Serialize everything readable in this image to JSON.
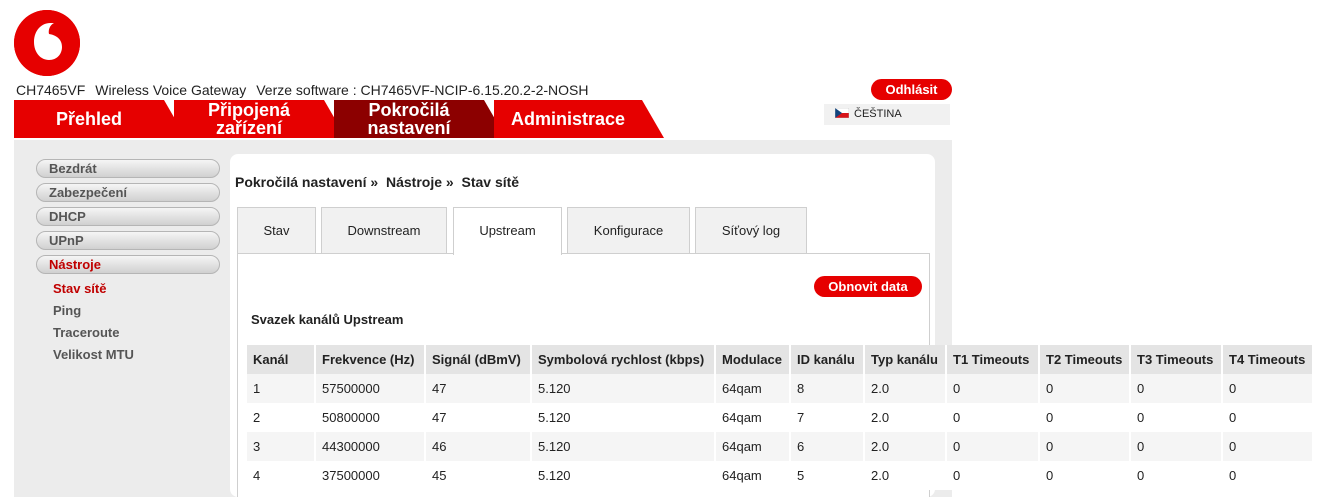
{
  "header": {
    "model": "CH7465VF",
    "product": "Wireless Voice Gateway",
    "software": "Verze software : CH7465VF-NCIP-6.15.20.2-2-NOSH",
    "logout_label": "Odhlásit",
    "language_label": "ČEŠTINA"
  },
  "nav": {
    "tab1": "Přehled",
    "tab2_line1": "Připojená",
    "tab2_line2": "zařízení",
    "tab3_line1": "Pokročilá",
    "tab3_line2": "nastavení",
    "tab4": "Administrace"
  },
  "sidebar": {
    "items": [
      "Bezdrát",
      "Zabezpečení",
      "DHCP",
      "UPnP",
      "Nástroje"
    ],
    "subitems": [
      "Stav sítě",
      "Ping",
      "Traceroute",
      "Velikost MTU"
    ]
  },
  "breadcrumb": {
    "part1": "Pokročilá nastavení",
    "sep": "»",
    "part2": "Nástroje",
    "part3": "Stav sítě"
  },
  "tabs": [
    "Stav",
    "Downstream",
    "Upstream",
    "Konfigurace",
    "Síťový log"
  ],
  "refresh_label": "Obnovit data",
  "section_title": "Svazek kanálů Upstream",
  "table": {
    "headers": [
      "Kanál",
      "Frekvence (Hz)",
      "Signál (dBmV)",
      "Symbolová rychlost (kbps)",
      "Modulace",
      "ID kanálu",
      "Typ kanálu",
      "T1 Timeouts",
      "T2 Timeouts",
      "T3 Timeouts",
      "T4 Timeouts"
    ],
    "rows": [
      [
        "1",
        "57500000",
        "47",
        "5.120",
        "64qam",
        "8",
        "2.0",
        "0",
        "0",
        "0",
        "0"
      ],
      [
        "2",
        "50800000",
        "47",
        "5.120",
        "64qam",
        "7",
        "2.0",
        "0",
        "0",
        "0",
        "0"
      ],
      [
        "3",
        "44300000",
        "46",
        "5.120",
        "64qam",
        "6",
        "2.0",
        "0",
        "0",
        "0",
        "0"
      ],
      [
        "4",
        "37500000",
        "45",
        "5.120",
        "64qam",
        "5",
        "2.0",
        "0",
        "0",
        "0",
        "0"
      ]
    ]
  },
  "colors": {
    "brand_red": "#e60000",
    "active_tab": "#8c0000",
    "panel_bg": "#ececec"
  }
}
